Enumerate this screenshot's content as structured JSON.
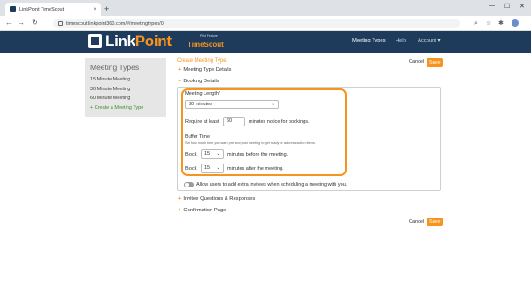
{
  "browser": {
    "tab_title": "LinkPoint TimeScout",
    "tab_close": "×",
    "new_tab": "+",
    "url": "timescout.linkpoint360.com/#/meetingtypes/0"
  },
  "header": {
    "logo_main_1": "Link",
    "logo_main_2": "Point",
    "logo_sub": "TimeScout",
    "logo_tag": "Pilot Feature",
    "nav": [
      "Meeting Types",
      "Help",
      "Account ▾"
    ]
  },
  "sidebar": {
    "title": "Meeting Types",
    "items": [
      "15 Minute Meeting",
      "30 Minute Meeting",
      "60 Minute Meeting",
      "+ Create a Meeting Type"
    ]
  },
  "main": {
    "title": "Create Meeting Type",
    "cancel_label": "Cancel",
    "save_label": "Save",
    "sections": {
      "details": "Meeting Type Details",
      "booking": "Booking Details",
      "questions": "Invitee Questions & Responses",
      "confirmation": "Confirmation Page"
    },
    "booking": {
      "length_label": "Meeting Length*",
      "length_value": "30 minutes",
      "require_prefix": "Require at least",
      "require_value": "60",
      "require_suffix": "minutes notice for bookings.",
      "buffer_title": "Buffer Time",
      "buffer_help": "Set how much time you want pre and post meeting to get ready or address action items.",
      "block_label": "Block",
      "before_value": "15",
      "before_suffix": "minutes before the meeting.",
      "after_value": "15",
      "after_suffix": "minutes after the meeting.",
      "invitees_label": "Allow users to add extra invitees when scheduling a meeting with you."
    }
  },
  "colors": {
    "header": "#1f3b5c",
    "accent": "#f7941d",
    "create_link": "#3c8d2f"
  }
}
